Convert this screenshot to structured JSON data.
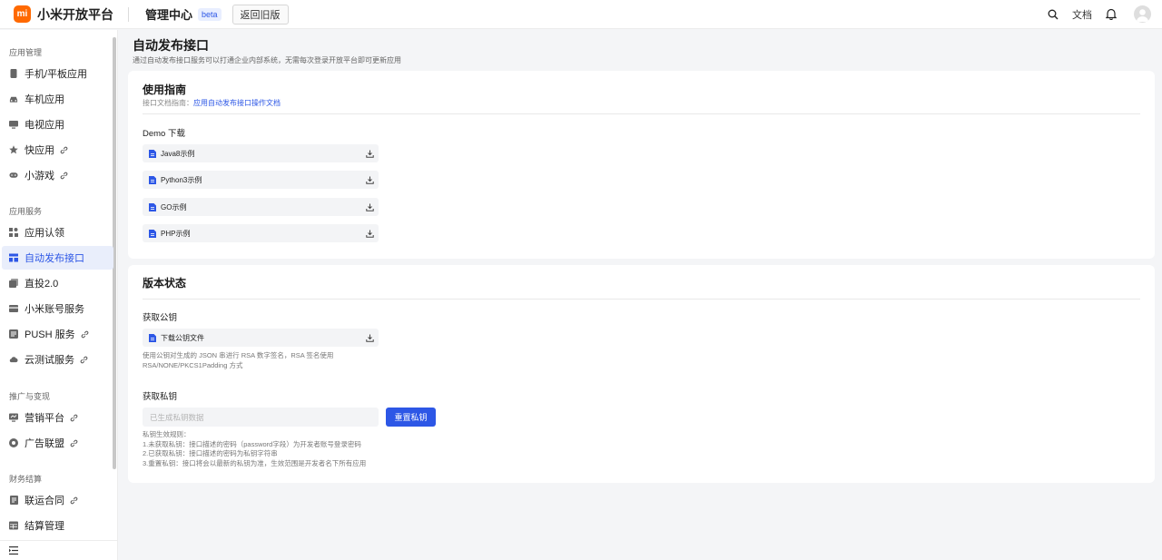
{
  "header": {
    "logo_text": "mi",
    "brand": "小米开放平台",
    "center_title": "管理中心",
    "badge": "beta",
    "back_button": "返回旧版",
    "docs_link": "文档",
    "icons": [
      "search-icon",
      "bell-icon",
      "avatar-icon"
    ]
  },
  "sidebar": {
    "groups": [
      {
        "title": "应用管理",
        "items": [
          {
            "label": "手机/平板应用",
            "icon": "phone-icon",
            "external": false
          },
          {
            "label": "车机应用",
            "icon": "car-icon",
            "external": false
          },
          {
            "label": "电视应用",
            "icon": "tv-icon",
            "external": false
          },
          {
            "label": "快应用",
            "icon": "star-icon",
            "external": true
          },
          {
            "label": "小游戏",
            "icon": "gamepad-icon",
            "external": true
          }
        ]
      },
      {
        "title": "应用服务",
        "items": [
          {
            "label": "应用认领",
            "icon": "apps-icon",
            "external": false
          },
          {
            "label": "自动发布接口",
            "icon": "api-icon",
            "external": false,
            "active": true
          },
          {
            "label": "直投2.0",
            "icon": "layers-icon",
            "external": false
          },
          {
            "label": "小米账号服务",
            "icon": "account-icon",
            "external": false
          },
          {
            "label": "PUSH 服务",
            "icon": "push-icon",
            "external": true
          },
          {
            "label": "云测试服务",
            "icon": "cloud-icon",
            "external": true
          }
        ]
      },
      {
        "title": "推广与变现",
        "items": [
          {
            "label": "营销平台",
            "icon": "marketing-icon",
            "external": true
          },
          {
            "label": "广告联盟",
            "icon": "ad-icon",
            "external": true
          }
        ]
      },
      {
        "title": "财务结算",
        "items": [
          {
            "label": "联运合同",
            "icon": "contract-icon",
            "external": true
          },
          {
            "label": "结算管理",
            "icon": "table-icon",
            "external": false
          }
        ]
      }
    ],
    "collapse_icon": "collapse-menu-icon"
  },
  "page": {
    "title": "自动发布接口",
    "description": "通过自动发布接口服务可以打通企业内部系统，无需每次登录开放平台即可更新应用"
  },
  "guide": {
    "title": "使用指南",
    "doc_prefix": "接口文档指南：",
    "doc_link": "应用自动发布接口操作文档",
    "demo_label": "Demo 下载",
    "demos": [
      "Java8示例",
      "Python3示例",
      "GO示例",
      "PHP示例"
    ]
  },
  "version": {
    "title": "版本状态",
    "public_key_label": "获取公钥",
    "public_key_file": "下载公钥文件",
    "public_key_note": [
      "使用公钥对生成的 JSON 串进行 RSA 数字签名，RSA 签名使用",
      "RSA/NONE/PKCS1Padding 方式"
    ],
    "private_key_label": "获取私钥",
    "private_key_placeholder": "已生成私钥数据",
    "reset_button": "重置私钥",
    "rules": [
      "私钥生效规则：",
      "1.未获取私钥：接口描述的密码（password字段）为开发者账号登录密码",
      "2.已获取私钥：接口描述的密码为私钥字符串",
      "3.重置私钥：接口将会以最新的私钥为准，生效范围是开发者名下所有应用"
    ]
  },
  "colors": {
    "brand_orange": "#ff6900",
    "accent_blue": "#2d57e6",
    "active_bg": "#e9eefb",
    "page_bg": "#f4f5f7"
  }
}
